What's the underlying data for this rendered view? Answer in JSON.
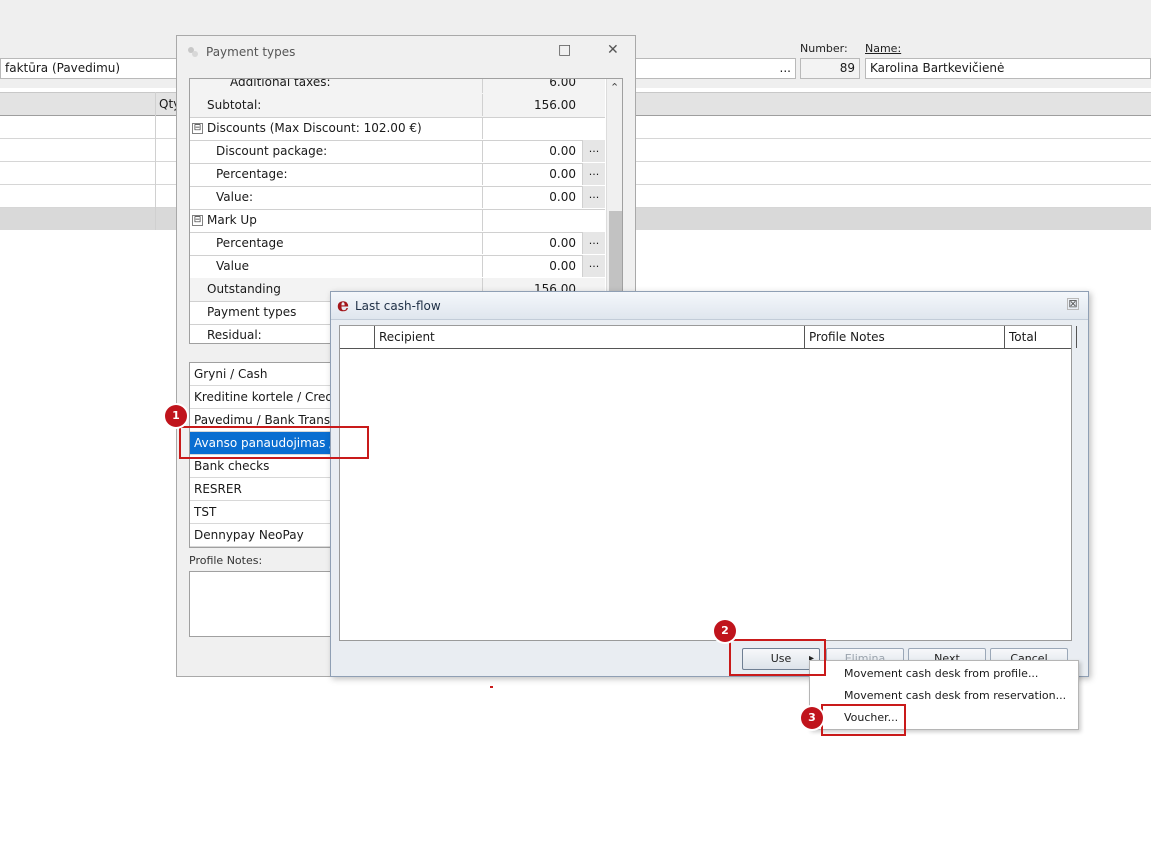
{
  "background_app": {
    "document_type": "faktūra (Pavedimu)",
    "ellipsis": "...",
    "number_label": "Number:",
    "number_value": "89",
    "name_label": "Name:",
    "name_value": "Karolina Bartkevičienė",
    "grid_header_qty": "Qty"
  },
  "payment_types_window": {
    "title": "Payment types",
    "maximize_icon": "□",
    "close_icon": "✕",
    "rows": [
      {
        "label": "Additional taxes:",
        "value": "6.00"
      },
      {
        "label": "Subtotal:",
        "value": "156.00"
      },
      {
        "label": "Discounts (Max Discount: 102.00 €)",
        "value": ""
      },
      {
        "label": "Discount package:",
        "value": "0.00",
        "button": "..."
      },
      {
        "label": "Percentage:",
        "value": "0.00",
        "button": "..."
      },
      {
        "label": "Value:",
        "value": "0.00",
        "button": "..."
      },
      {
        "label": "Mark Up",
        "value": ""
      },
      {
        "label": "Percentage",
        "value": "0.00",
        "button": "..."
      },
      {
        "label": "Value",
        "value": "0.00",
        "button": "..."
      },
      {
        "label": "Outstanding",
        "value": "156.00"
      },
      {
        "label": "Payment types",
        "value": ""
      },
      {
        "label": "Residual:",
        "value": ""
      }
    ],
    "expander_symbol": "⊟",
    "scroll_up_icon": "⌃",
    "payment_methods": [
      "Gryni / Cash",
      "Kreditine kortele / Credit",
      "Pavedimu / Bank Transfer",
      "Avanso panaudojimas / U",
      "Bank checks",
      "RESRER",
      "TST",
      "Dennypay NeoPay"
    ],
    "selected_method_index": 3,
    "profile_notes_label": "Profile Notes:"
  },
  "cash_flow_dialog": {
    "logo": "e",
    "title": "Last cash-flow",
    "close_icon": "⊠",
    "columns": [
      "Recipient",
      "Profile Notes",
      "Total"
    ],
    "buttons": {
      "use": "Use",
      "eliminate": "Elimina",
      "next": "Next",
      "cancel": "Cancel"
    },
    "dropdown_arrow": "▸"
  },
  "context_menu": {
    "items": [
      "Movement cash desk from profile...",
      "Movement cash desk from reservation...",
      "Voucher..."
    ]
  },
  "annotations": {
    "badges": [
      "1",
      "2",
      "3"
    ],
    "highlight_color": "#c91a1a",
    "selection_color": "#0a6ed1"
  }
}
